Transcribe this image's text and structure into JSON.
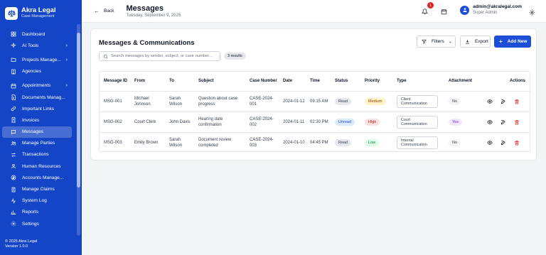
{
  "sidebar": {
    "brand_name": "Akra Legal",
    "brand_sub": "Case Management",
    "items": [
      {
        "label": "Dashboard",
        "icon": "dashboard-icon"
      },
      {
        "label": "AI Tools",
        "icon": "sparkle-icon",
        "chevron": "›"
      },
      {
        "label": "Projects Manage...",
        "icon": "folder-icon",
        "chevron": "›"
      },
      {
        "label": "Agencies",
        "icon": "building-icon"
      },
      {
        "label": "Appointments",
        "icon": "calendar-icon",
        "chevron": "›"
      },
      {
        "label": "Documents Manag...",
        "icon": "document-icon"
      },
      {
        "label": "Important Links",
        "icon": "link-icon"
      },
      {
        "label": "Invoices",
        "icon": "invoice-icon"
      },
      {
        "label": "Messages",
        "icon": "message-icon",
        "active": true
      },
      {
        "label": "Manage Parties",
        "icon": "users-icon"
      },
      {
        "label": "Transactions",
        "icon": "transactions-icon"
      },
      {
        "label": "Human Resources",
        "icon": "people-icon"
      },
      {
        "label": "Accounts Manage...",
        "icon": "accounts-icon"
      },
      {
        "label": "Manage Claims",
        "icon": "claims-icon"
      },
      {
        "label": "System Log",
        "icon": "log-icon"
      },
      {
        "label": "Reports",
        "icon": "reports-icon"
      },
      {
        "label": "Settings",
        "icon": "gear-icon"
      }
    ],
    "footer_line1": "© 2025 Akra Legal",
    "footer_line2": "Version 1.0.0"
  },
  "topbar": {
    "back_label": "Back",
    "title": "Messages",
    "date": "Tuesday, September 9, 2025",
    "notification_count": "1",
    "user_email": "admin@akralegal.com",
    "user_role": "Super Admin"
  },
  "card": {
    "title": "Messages & Communications",
    "filters_label": "Filters",
    "export_label": "Export",
    "add_label": "Add New",
    "search_placeholder": "Search messages by sender, subject, or case number...",
    "results_label": "3 results"
  },
  "table": {
    "headers": [
      "Message ID",
      "From",
      "To",
      "Subject",
      "Case Number",
      "Date",
      "Time",
      "Status",
      "Priority",
      "Type",
      "Attachment",
      "Actions"
    ],
    "rows": [
      {
        "id": "MSG-001",
        "from": "Michael Johnson",
        "to": "Sarah Wilson",
        "subject": "Question about case progress",
        "case": "CASE-2024-001",
        "date": "2024-01-12",
        "time": "09:15 AM",
        "status": "Read",
        "priority": "Medium",
        "type": "Client Communication",
        "attachment": "No"
      },
      {
        "id": "MSG-002",
        "from": "Court Clerk",
        "to": "John Davis",
        "subject": "Hearing date confirmation",
        "case": "CASE-2024-002",
        "date": "2024-01-11",
        "time": "02:30 PM",
        "status": "Unread",
        "priority": "High",
        "type": "Court Communication",
        "attachment": "Yes"
      },
      {
        "id": "MSG-003",
        "from": "Emily Brown",
        "to": "Sarah Wilson",
        "subject": "Document review completed",
        "case": "CASE-2024-003",
        "date": "2024-01-10",
        "time": "04:45 PM",
        "status": "Read",
        "priority": "Low",
        "type": "Internal Communication",
        "attachment": "No"
      }
    ]
  },
  "colors": {
    "sidebar_bg": "#1545c7",
    "accent": "#1d4ed8",
    "status_read_bg": "#e5e7eb",
    "status_unread_bg": "#dbeafe",
    "priority_medium_bg": "#fef3c7",
    "priority_high_bg": "#fee2e2",
    "priority_low_bg": "#dcfce7",
    "attachment_yes_bg": "#f3e8ff",
    "delete_color": "#dc2626"
  }
}
